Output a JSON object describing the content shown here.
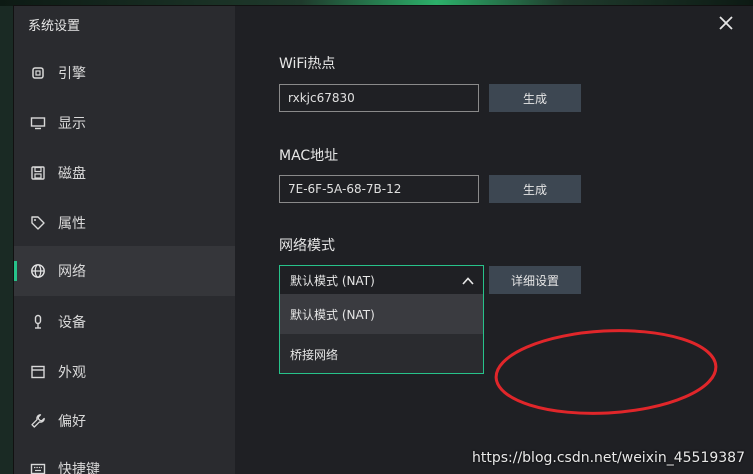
{
  "window": {
    "title": "系统设置"
  },
  "sidebar": {
    "items": [
      {
        "label": "引擎",
        "icon": "chip-icon"
      },
      {
        "label": "显示",
        "icon": "monitor-icon"
      },
      {
        "label": "磁盘",
        "icon": "disk-icon"
      },
      {
        "label": "属性",
        "icon": "tag-icon"
      },
      {
        "label": "网络",
        "icon": "globe-icon",
        "active": true
      },
      {
        "label": "设备",
        "icon": "mic-icon"
      },
      {
        "label": "外观",
        "icon": "window-icon"
      },
      {
        "label": "偏好",
        "icon": "wrench-icon"
      },
      {
        "label": "快捷键",
        "icon": "keyboard-icon"
      }
    ]
  },
  "wifi": {
    "label": "WiFi热点",
    "value": "rxkjc67830",
    "button": "生成"
  },
  "mac": {
    "label": "MAC地址",
    "value": "7E-6F-5A-68-7B-12",
    "button": "生成"
  },
  "network_mode": {
    "label": "网络模式",
    "selected": "默认模式 (NAT)",
    "button": "详细设置",
    "options": [
      "默认模式 (NAT)",
      "桥接网络"
    ]
  },
  "watermark": "https://blog.csdn.net/weixin_45519387",
  "colors": {
    "accent": "#27c28a",
    "button_bg": "#3d4752",
    "annotation": "#e0262a"
  }
}
